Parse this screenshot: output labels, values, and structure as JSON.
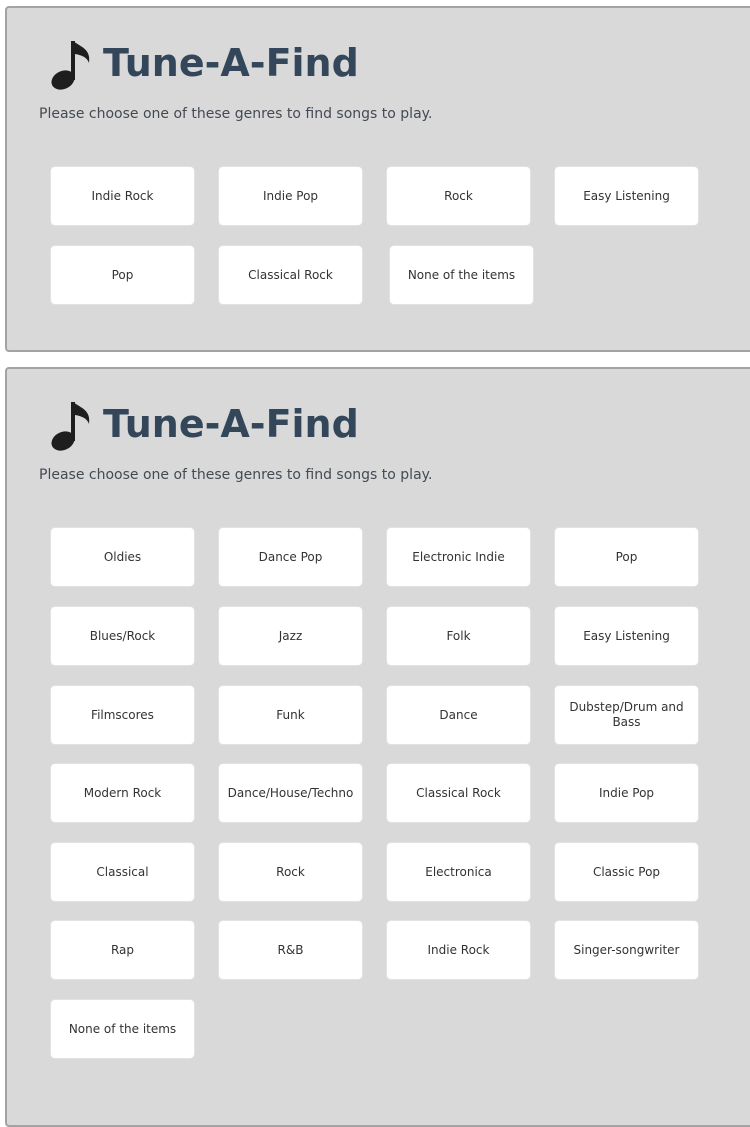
{
  "app": {
    "title": "Tune-A-Find",
    "icon": "music-note-icon"
  },
  "colors": {
    "title": "#34475a",
    "panel_bg": "#d9d9d9",
    "button_bg": "#ffffff"
  },
  "panels": [
    {
      "instructions": "Please choose one of these genres to find songs to play.",
      "options": [
        "Indie Rock",
        "Indie Pop",
        "Rock",
        "Easy Listening",
        "Pop",
        "Classical Rock",
        "None of the items"
      ]
    },
    {
      "instructions": "Please choose one of these genres to find songs to play.",
      "options": [
        "Oldies",
        "Dance Pop",
        "Electronic Indie",
        "Pop",
        "Blues/Rock",
        "Jazz",
        "Folk",
        "Easy Listening",
        "Filmscores",
        "Funk",
        "Dance",
        "Dubstep/Drum and Bass",
        "Modern Rock",
        "Dance/House/Techno",
        "Classical Rock",
        "Indie Pop",
        "Classical",
        "Rock",
        "Electronica",
        "Classic Pop",
        "Rap",
        "R&B",
        "Indie Rock",
        "Singer-songwriter",
        "None of the items"
      ]
    }
  ]
}
